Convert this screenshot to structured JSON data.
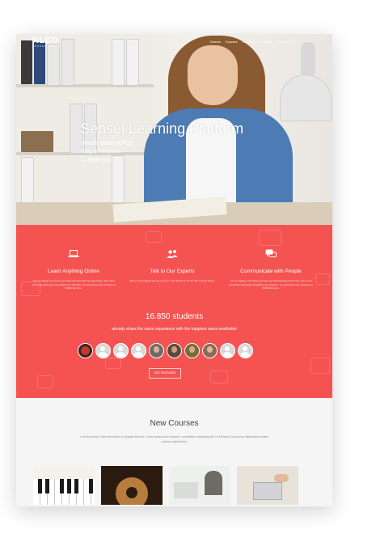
{
  "header": {
    "logo": "KLEO",
    "logo_sub": "SENSEI LMS",
    "nav": [
      "Demos",
      "Courses",
      "Lessons",
      "Members",
      "Contact Us"
    ]
  },
  "hero": {
    "title": "Sensei Learning Platform",
    "subtitle_line1": "Details made perfect",
    "subtitle_line2": "Blog & Lessons",
    "more_link": "— More Info"
  },
  "features": [
    {
      "icon": "laptop-icon",
      "title": "Learn Anything Online",
      "text": "Join our happy community, get help and start learning new things. Also we're constantly improving and adding new features. You get all the new versions for FREE this time."
    },
    {
      "icon": "users-icon",
      "title": "Talk to Our Experts",
      "text": "Many great features are set to come in the theme so be the first to know about."
    },
    {
      "icon": "chat-icon",
      "title": "Communicate with People",
      "text": "Join our happy community, get help and start learning new things. Also we're constantly improving and adding new features. You get all the new versions for FREE this time."
    }
  ],
  "stats": {
    "students": "16.850 students",
    "subtitle": "already share the same experience with the happiest users worldwide",
    "button": "SEE FEATURES"
  },
  "courses": {
    "title": "New Courses",
    "text": "I am text block. Click edit button to change this text. Lorem ipsum dolor sit amet, consectetur adipiscing elit. Ut elit tellus, luctus nec ullamcorper mattis, pulvinar dapibus leo."
  },
  "colors": {
    "accent": "#f45352",
    "hero_text": "#ffffff"
  }
}
